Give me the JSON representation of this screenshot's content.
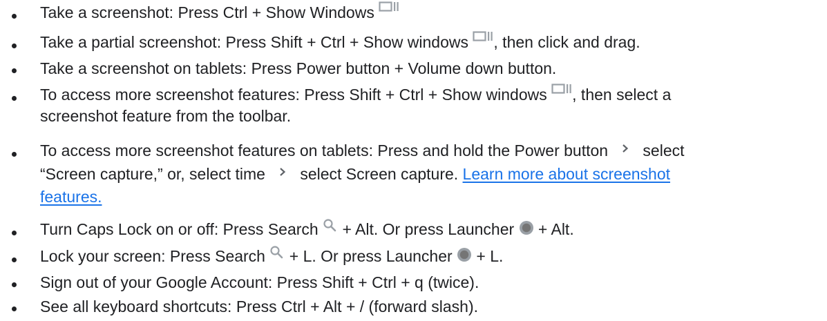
{
  "items": [
    {
      "pre": "Take a screenshot: Press Ctrl + Show Windows",
      "icon": "show-windows-icon"
    },
    {
      "pre": "Take a partial screenshot: Press Shift + Ctrl + Show windows",
      "icon": "show-windows-icon",
      "post": ", then click and drag."
    },
    {
      "text": "Take a screenshot on tablets: Press Power button + Volume down button."
    },
    {
      "pre": "To access more screenshot features: Press Shift + Ctrl + Show windows",
      "icon": "show-windows-icon",
      "post": ", then select a",
      "line2": "screenshot feature from the toolbar."
    },
    {
      "seg1": "To access more screenshot features on tablets: Press and hold the Power button",
      "seg2": "select",
      "seg3": "“Screen capture,” or, select time",
      "seg4": "select Screen capture.",
      "link_part1": "Learn more about screenshot",
      "link_part2": "features.",
      "chevron_icon": "chevron-right-icon"
    },
    {
      "pre": "Turn Caps Lock on or off: Press Search",
      "mid": "+ Alt. Or press Launcher",
      "post": "+ Alt."
    },
    {
      "pre": "Lock your screen: Press Search",
      "mid": "+ L. Or press Launcher",
      "post": "+ L."
    },
    {
      "text": "Sign out of your Google Account: Press Shift + Ctrl + q (twice)."
    },
    {
      "text": "See all keyboard shortcuts: Press Ctrl + Alt + / (forward slash)."
    }
  ],
  "colors": {
    "text": "#202124",
    "link": "#1a73e8",
    "icon": "#9aa0a6"
  }
}
